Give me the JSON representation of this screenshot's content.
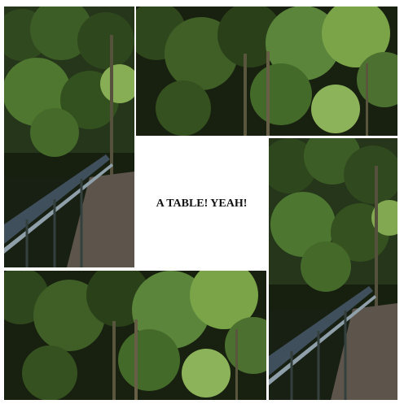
{
  "caption": "A TABLE! YEAH!",
  "colors": {
    "background": "#ffffff",
    "foliage_dark": "#18210f",
    "foliage_mid": "#2f4a1f",
    "foliage_light": "#7da64a",
    "railing": "#465562",
    "bridge_deck": "#62574f"
  },
  "images": [
    {
      "name": "forest-bridge-photo-left",
      "subject": "forest-bridge"
    },
    {
      "name": "forest-photo-top",
      "subject": "forest"
    },
    {
      "name": "forest-bridge-photo-right",
      "subject": "forest-bridge"
    },
    {
      "name": "forest-photo-bottom",
      "subject": "forest"
    }
  ]
}
